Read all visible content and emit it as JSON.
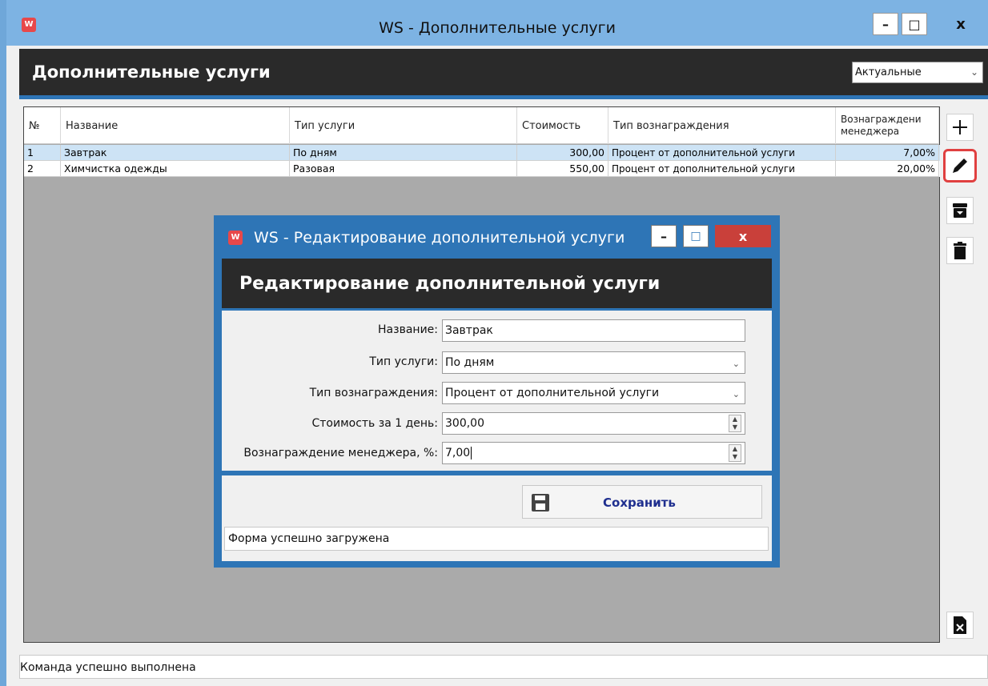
{
  "window": {
    "title": "WS - Дополнительные услуги",
    "minimize": "–",
    "maximize": "□",
    "close": "x"
  },
  "header": {
    "title": "Дополнительные услуги",
    "filter_value": "Актуальные"
  },
  "table": {
    "columns": [
      "№",
      "Название",
      "Тип услуги",
      "Стоимость",
      "Тип вознаграждения",
      "Вознаграждени менеджера"
    ],
    "rows": [
      {
        "num": "1",
        "name": "Завтрак",
        "type": "По дням",
        "cost": "300,00",
        "reward_type": "Процент от дополнительной услуги",
        "reward": "7,00%"
      },
      {
        "num": "2",
        "name": "Химчистка одежды",
        "type": "Разовая",
        "cost": "550,00",
        "reward_type": "Процент от дополнительной услуги",
        "reward": "20,00%"
      }
    ]
  },
  "sidebar": {
    "icons": [
      "plus-icon",
      "pencil-icon",
      "archive-icon",
      "trash-icon",
      "export-icon"
    ]
  },
  "dialog": {
    "title": "WS - Редактирование дополнительной услуги",
    "minimize": "–",
    "maximize": "□",
    "close": "x",
    "header": "Редактирование дополнительной услуги",
    "fields": {
      "name_label": "Название:",
      "name_value": "Завтрак",
      "type_label": "Тип услуги:",
      "type_value": "По дням",
      "reward_type_label": "Тип вознаграждения:",
      "reward_type_value": "Процент от дополнительной услуги",
      "cost_label": "Стоимость за 1 день:",
      "cost_value": "300,00",
      "reward_label": "Вознаграждение менеджера, %:",
      "reward_value": "7,00"
    },
    "save_label": "Сохранить",
    "status": "Форма успешно загружена"
  },
  "status_bar": {
    "text": "Команда успешно выполнена"
  },
  "colors": {
    "accent_blue": "#2e75b6",
    "header_dark": "#2a2a2a",
    "selection": "#cde3f5",
    "highlight_red": "#e04040"
  }
}
